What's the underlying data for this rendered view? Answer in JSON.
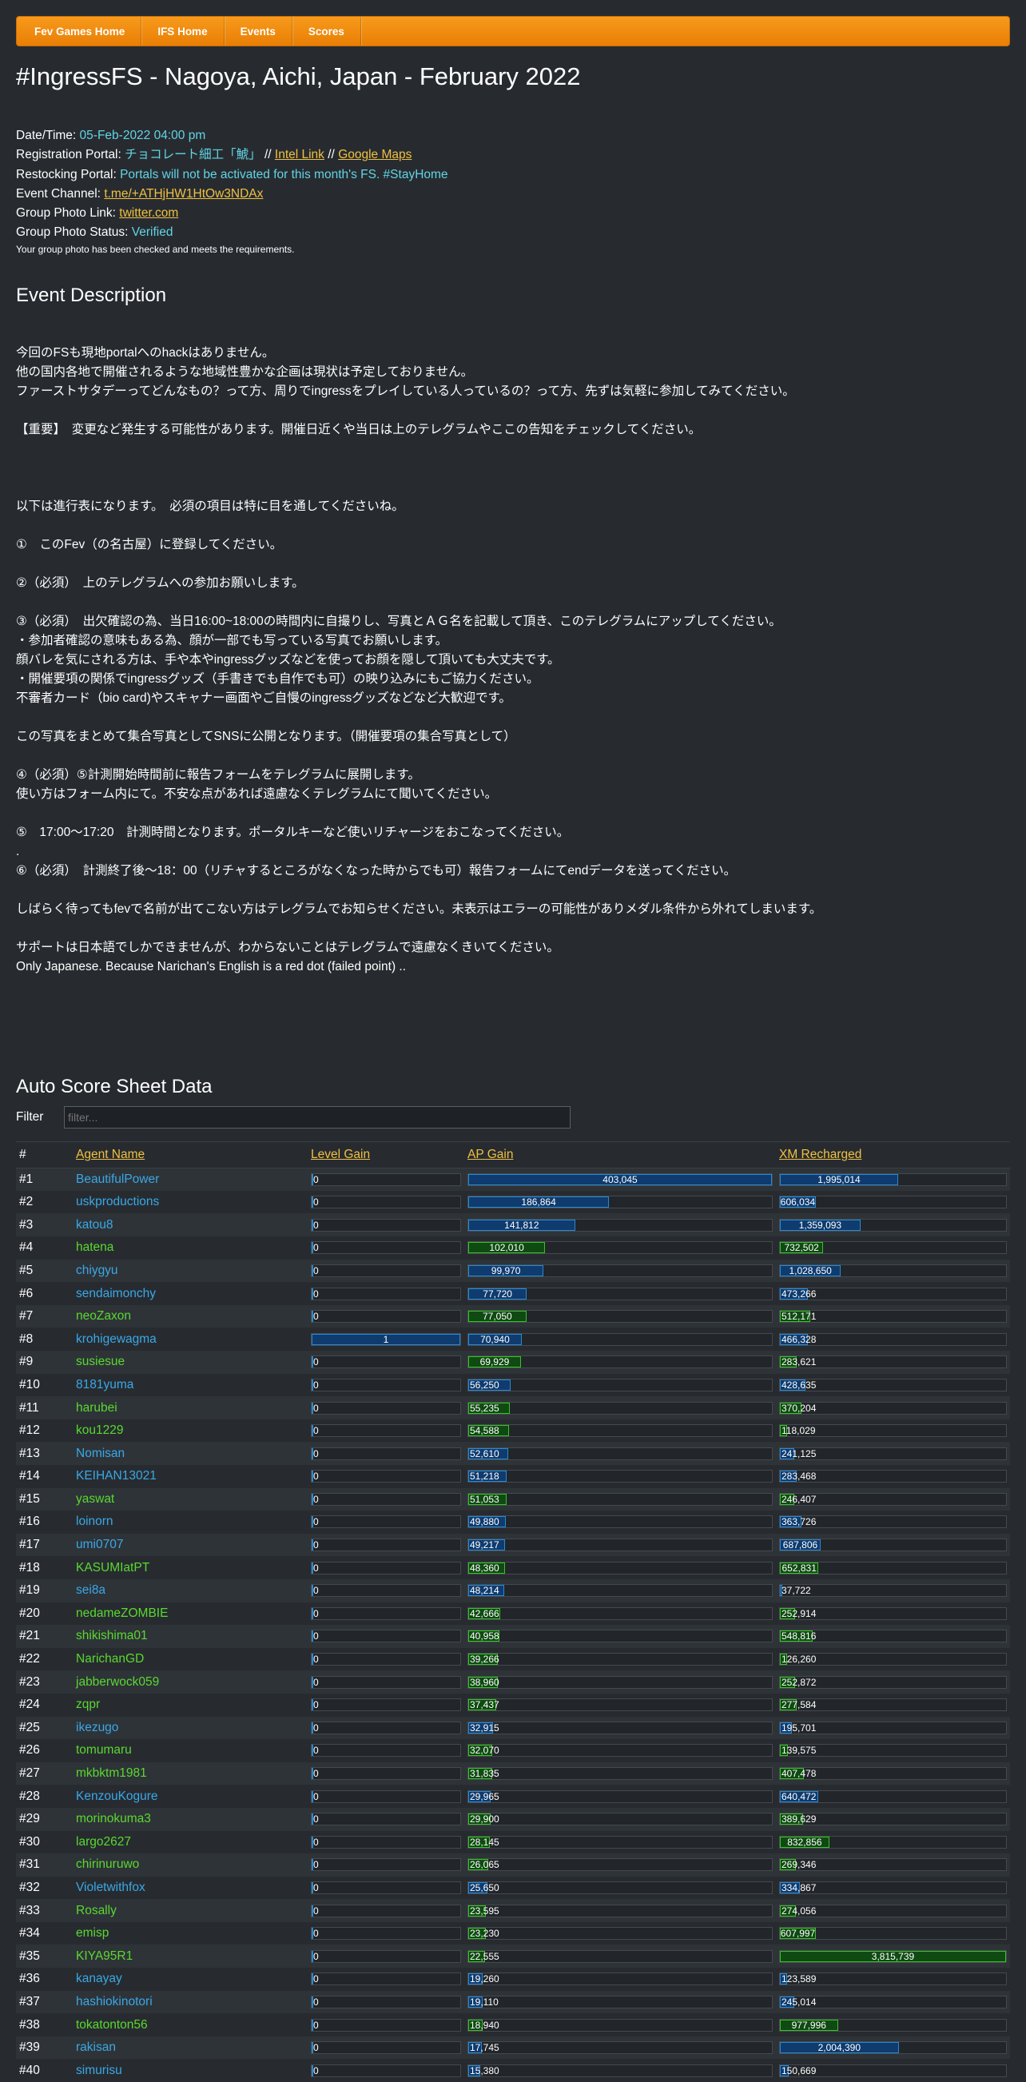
{
  "nav": [
    "Fev Games Home",
    "IFS Home",
    "Events",
    "Scores"
  ],
  "title": "#IngressFS - Nagoya, Aichi, Japan - February 2022",
  "info": {
    "datetime_label": "Date/Time:",
    "datetime_value": "05-Feb-2022 04:00 pm",
    "reg_label": "Registration Portal:",
    "reg_portal": "チョコレート細工「鯱」",
    "sep1": "//",
    "intel_link": "Intel Link",
    "sep2": "//",
    "maps_link": "Google Maps",
    "restock_label": "Restocking Portal:",
    "restock_value": "Portals will not be activated for this month's FS. #StayHome",
    "channel_label": "Event Channel:",
    "channel_link": "t.me/+ATHjHW1HtOw3NDAx",
    "photo_link_label": "Group Photo Link:",
    "photo_link": "twitter.com",
    "photo_status_label": "Group Photo Status:",
    "photo_status_value": "Verified",
    "photo_note": "Your group photo has been checked and meets the requirements."
  },
  "description_heading": "Event Description",
  "description_lines": [
    "",
    "今回のFSも現地portalへのhackはありません。",
    "他の国内各地で開催されるような地域性豊かな企画は現状は予定しておりません。",
    "ファーストサタデーってどんなもの？って方、周りでingressをプレイしている人っているの？って方、先ずは気軽に参加してみてください。",
    "",
    "【重要】　変更など発生する可能性があります。開催日近くや当日は上のテレグラムやここの告知をチェックしてください。",
    "",
    "",
    "",
    "以下は進行表になります。　必須の項目は特に目を通してくださいね。",
    "",
    "①　このFev（の名古屋）に登録してください。",
    "",
    "②（必須）　上のテレグラムへの参加お願いします。",
    "",
    "③（必須）　出欠確認の為、当日16:00~18:00の時間内に自撮りし、写真とＡＧ名を記載して頂き、このテレグラムにアップしてください。",
    "・参加者確認の意味もある為、顔が一部でも写っている写真でお願いします。",
    "顔バレを気にされる方は、手や本やingressグッズなどを使ってお顔を隠して頂いても大丈夫です。",
    "・開催要項の関係でingressグッズ（手書きでも自作でも可）の映り込みにもご協力ください。",
    "不審者カード（bio card)やスキャナー画面やご自慢のingressグッズなどなど大歓迎です。",
    "",
    "この写真をまとめて集合写真としてSNSに公開となります。（開催要項の集合写真として）",
    "",
    "④（必須）⑤計測開始時間前に報告フォームをテレグラムに展開します。",
    "使い方はフォーム内にて。不安な点があれば遠慮なくテレグラムにて聞いてください。",
    "",
    "⑤　17:00～17:20　計測時間となります。ポータルキーなど使いリチャージをおこなってください。",
    ".",
    "⑥（必須）　計測終了後～18：00（リチャするところがなくなった時からでも可）報告フォームにてendデータを送ってください。",
    "",
    "しばらく待ってもfevで名前が出てこない方はテレグラムでお知らせください。未表示はエラーの可能性がありメダル条件から外れてしまいます。",
    "",
    "サポートは日本語でしかできませんが、わからないことはテレグラムで遠慮なくきいてください。",
    "Only Japanese. Because Narichan's English is a red dot (failed point) .."
  ],
  "scores_heading": "Auto Score Sheet Data",
  "filter": {
    "label": "Filter",
    "placeholder": "filter..."
  },
  "table": {
    "headers": [
      "#",
      "Agent Name",
      "Level Gain",
      "AP Gain",
      "XM Recharged"
    ],
    "rows": [
      {
        "rank": "#1",
        "agent": "BeautifulPower",
        "team": "blue",
        "level": "0",
        "ap": "403,045",
        "xm": "1,995,014"
      },
      {
        "rank": "#2",
        "agent": "uskproductions",
        "team": "blue",
        "level": "0",
        "ap": "186,864",
        "xm": "606,034"
      },
      {
        "rank": "#3",
        "agent": "katou8",
        "team": "blue",
        "level": "0",
        "ap": "141,812",
        "xm": "1,359,093"
      },
      {
        "rank": "#4",
        "agent": "hatena",
        "team": "green",
        "level": "0",
        "ap": "102,010",
        "xm": "732,502"
      },
      {
        "rank": "#5",
        "agent": "chiygyu",
        "team": "blue",
        "level": "0",
        "ap": "99,970",
        "xm": "1,028,650"
      },
      {
        "rank": "#6",
        "agent": "sendaimonchy",
        "team": "blue",
        "level": "0",
        "ap": "77,720",
        "xm": "473,266"
      },
      {
        "rank": "#7",
        "agent": "neoZaxon",
        "team": "green",
        "level": "0",
        "ap": "77,050",
        "xm": "512,171"
      },
      {
        "rank": "#8",
        "agent": "krohigewagma",
        "team": "blue",
        "level": "1",
        "ap": "70,940",
        "xm": "466,328"
      },
      {
        "rank": "#9",
        "agent": "susiesue",
        "team": "green",
        "level": "0",
        "ap": "69,929",
        "xm": "283,621"
      },
      {
        "rank": "#10",
        "agent": "8181yuma",
        "team": "blue",
        "level": "0",
        "ap": "56,250",
        "xm": "428,635"
      },
      {
        "rank": "#11",
        "agent": "harubei",
        "team": "green",
        "level": "0",
        "ap": "55,235",
        "xm": "370,204"
      },
      {
        "rank": "#12",
        "agent": "kou1229",
        "team": "green",
        "level": "0",
        "ap": "54,588",
        "xm": "118,029"
      },
      {
        "rank": "#13",
        "agent": "Nomisan",
        "team": "blue",
        "level": "0",
        "ap": "52,610",
        "xm": "241,125"
      },
      {
        "rank": "#14",
        "agent": "KEIHAN13021",
        "team": "blue",
        "level": "0",
        "ap": "51,218",
        "xm": "283,468"
      },
      {
        "rank": "#15",
        "agent": "yaswat",
        "team": "green",
        "level": "0",
        "ap": "51,053",
        "xm": "246,407"
      },
      {
        "rank": "#16",
        "agent": "loinorn",
        "team": "blue",
        "level": "0",
        "ap": "49,880",
        "xm": "363,726"
      },
      {
        "rank": "#17",
        "agent": "umi0707",
        "team": "blue",
        "level": "0",
        "ap": "49,217",
        "xm": "687,806"
      },
      {
        "rank": "#18",
        "agent": "KASUMIatPT",
        "team": "green",
        "level": "0",
        "ap": "48,360",
        "xm": "652,831"
      },
      {
        "rank": "#19",
        "agent": "sei8a",
        "team": "blue",
        "level": "0",
        "ap": "48,214",
        "xm": "37,722"
      },
      {
        "rank": "#20",
        "agent": "nedameZOMBIE",
        "team": "green",
        "level": "0",
        "ap": "42,666",
        "xm": "252,914"
      },
      {
        "rank": "#21",
        "agent": "shikishima01",
        "team": "green",
        "level": "0",
        "ap": "40,958",
        "xm": "548,816"
      },
      {
        "rank": "#22",
        "agent": "NarichanGD",
        "team": "green",
        "level": "0",
        "ap": "39,266",
        "xm": "126,260"
      },
      {
        "rank": "#23",
        "agent": "jabberwock059",
        "team": "green",
        "level": "0",
        "ap": "38,960",
        "xm": "252,872"
      },
      {
        "rank": "#24",
        "agent": "zqpr",
        "team": "green",
        "level": "0",
        "ap": "37,437",
        "xm": "277,584"
      },
      {
        "rank": "#25",
        "agent": "ikezugo",
        "team": "blue",
        "level": "0",
        "ap": "32,915",
        "xm": "195,701"
      },
      {
        "rank": "#26",
        "agent": "tomumaru",
        "team": "green",
        "level": "0",
        "ap": "32,070",
        "xm": "139,575"
      },
      {
        "rank": "#27",
        "agent": "mkbktm1981",
        "team": "green",
        "level": "0",
        "ap": "31,835",
        "xm": "407,478"
      },
      {
        "rank": "#28",
        "agent": "KenzouKogure",
        "team": "blue",
        "level": "0",
        "ap": "29,965",
        "xm": "640,472"
      },
      {
        "rank": "#29",
        "agent": "morinokuma3",
        "team": "green",
        "level": "0",
        "ap": "29,900",
        "xm": "389,629"
      },
      {
        "rank": "#30",
        "agent": "largo2627",
        "team": "green",
        "level": "0",
        "ap": "28,145",
        "xm": "832,856"
      },
      {
        "rank": "#31",
        "agent": "chirinuruwo",
        "team": "green",
        "level": "0",
        "ap": "26,065",
        "xm": "269,346"
      },
      {
        "rank": "#32",
        "agent": "Violetwithfox",
        "team": "blue",
        "level": "0",
        "ap": "25,650",
        "xm": "334,867"
      },
      {
        "rank": "#33",
        "agent": "Rosally",
        "team": "green",
        "level": "0",
        "ap": "23,595",
        "xm": "274,056"
      },
      {
        "rank": "#34",
        "agent": "emisp",
        "team": "green",
        "level": "0",
        "ap": "23,230",
        "xm": "607,997"
      },
      {
        "rank": "#35",
        "agent": "KIYA95R1",
        "team": "green",
        "level": "0",
        "ap": "22,555",
        "xm": "3,815,739"
      },
      {
        "rank": "#36",
        "agent": "kanayay",
        "team": "blue",
        "level": "0",
        "ap": "19,260",
        "xm": "123,589"
      },
      {
        "rank": "#37",
        "agent": "hashiokinotori",
        "team": "blue",
        "level": "0",
        "ap": "19,110",
        "xm": "245,014"
      },
      {
        "rank": "#38",
        "agent": "tokatonton56",
        "team": "green",
        "level": "0",
        "ap": "18,940",
        "xm": "977,996"
      },
      {
        "rank": "#39",
        "agent": "rakisan",
        "team": "blue",
        "level": "0",
        "ap": "17,745",
        "xm": "2,004,390"
      },
      {
        "rank": "#40",
        "agent": "simurisu",
        "team": "blue",
        "level": "0",
        "ap": "15,380",
        "xm": "150,669"
      }
    ]
  },
  "colors": {
    "blue_team": "#3aa8e6",
    "green_team": "#5ad82f",
    "nav_orange": "#f08c10",
    "link_yellow": "#f0c040",
    "teal": "#62d4e4"
  }
}
